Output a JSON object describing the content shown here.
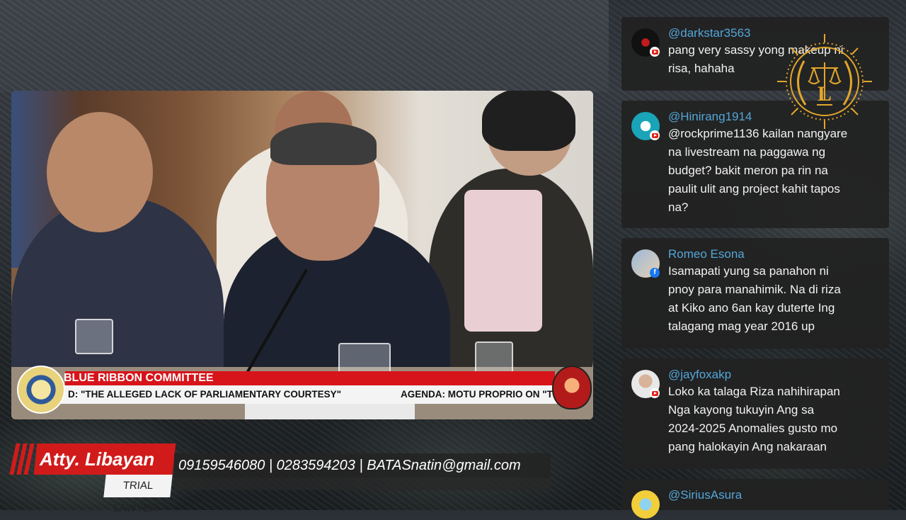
{
  "video": {
    "committee_banner": "BLUE RIBBON COMMITTEE",
    "agenda_left": "D: \"THE ALLEGED LACK OF PARLIAMENTARY COURTESY\"",
    "agenda_right": "AGENDA:  MOTU PROPRIO ON \"T"
  },
  "brand": {
    "name": "Atty. Libayan",
    "title": "TRIAL LAWYER",
    "contact": "09159546080 | 0283594203 | BATASnatin@gmail.com"
  },
  "chat": {
    "messages": [
      {
        "author": "@darkstar3563",
        "platform": "youtube",
        "text": "pang very sassy yong makeup ni\nrisa, hahaha"
      },
      {
        "author": "@Hinirang1914",
        "platform": "youtube",
        "text": "@rockprime1136 kailan nangyare\nna livestream na paggawa ng\nbudget? bakit meron pa rin na\npaulit ulit ang project kahit tapos\nna?"
      },
      {
        "author": "Romeo Esona",
        "platform": "facebook",
        "text": "Isamapati yung sa panahon ni\npnoy para manahimik. Na di riza\nat Kiko ano 6an kay duterte Ing\ntalagang mag year 2016 up"
      },
      {
        "author": "@jayfoxakp",
        "platform": "youtube",
        "text": "Loko ka talaga Riza nahihirapan\nNga kayong tukuyin Ang sa\n2024-2025 Anomalies gusto mo\npang halokayin Ang nakaraan"
      },
      {
        "author": "@SiriusAsura",
        "platform": "youtube",
        "text": ""
      }
    ]
  },
  "colors": {
    "accent_red": "#d11b1b",
    "author_blue": "#53a6d8",
    "chat_bg": "#222222"
  }
}
